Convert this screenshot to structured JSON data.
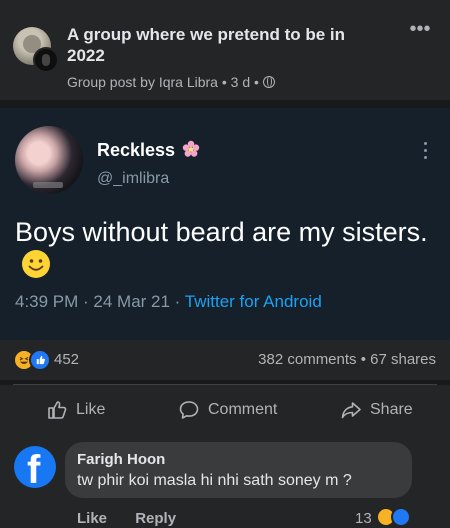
{
  "post": {
    "group_title": "A group where we pretend to be in 2022",
    "meta": "Group post by Iqra Libra • 3 d •",
    "more_icon": "more-horizontal-icon"
  },
  "tweet": {
    "name": "Reckless",
    "handle": "@_imlibra",
    "text": "Boys without beard are my sisters.",
    "time": "4:39 PM · 24 Mar 21 · ",
    "source": "Twitter for Android"
  },
  "stats": {
    "reaction_count": "452",
    "counts": "382 comments • 67 shares"
  },
  "actions": {
    "like": "Like",
    "comment": "Comment",
    "share": "Share"
  },
  "comment": {
    "author": "Farigh Hoon",
    "text": "tw phir koi masla hi nhi sath soney m ?",
    "like": "Like",
    "reply": "Reply",
    "reaction_count": "13"
  },
  "colors": {
    "background": "#18191a",
    "card": "#242526",
    "tweet_bg": "#15202b",
    "twitter_blue": "#1da1f2",
    "facebook_blue": "#1877f2"
  }
}
